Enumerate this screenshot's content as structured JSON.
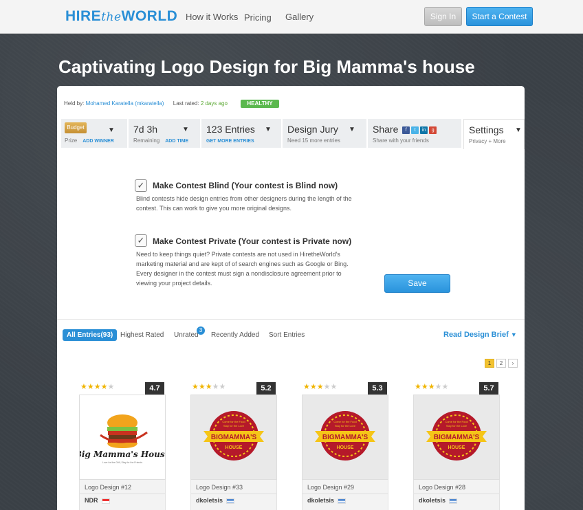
{
  "brand": {
    "part1": "HIRE",
    "part2": "the",
    "part3": "WORLD",
    "color": "#2a8fd6"
  },
  "nav": {
    "how": "How it Works",
    "pricing": "Pricing",
    "gallery": "Gallery",
    "signin": "Sign In",
    "start": "Start a Contest"
  },
  "title": "Captivating Logo Design for Big Mamma's house",
  "held": {
    "label": "Held by:",
    "user": "Mohamed Karatella (mkaratella)",
    "rated_label": "Last rated:",
    "rated_value": "2 days ago",
    "status": "HEALTHY"
  },
  "tabs": {
    "budget": {
      "chip": "Budget",
      "sub": "Prize",
      "link": "ADD WINNER"
    },
    "time": {
      "big": "7d 3h",
      "sub": "Remaining",
      "link": "ADD TIME"
    },
    "entries": {
      "big": "123 Entries",
      "link": "GET MORE ENTRIES"
    },
    "jury": {
      "big": "Design Jury",
      "sub": "Need 15 more entries"
    },
    "share": {
      "big": "Share",
      "sub": "Share with your friends"
    },
    "settings": {
      "big": "Settings",
      "sub": "Privacy + More"
    }
  },
  "options": {
    "blind": {
      "title": "Make Contest Blind  (Your contest  is Blind now)",
      "desc": "Blind contests hide design entries from other designers during the length of the contest. This can work to give you more original designs.",
      "checked": true
    },
    "private": {
      "title": "Make Contest Private (Your contest is Private now)",
      "desc": "Need to keep things quiet? Private contests are not used in HiretheWorld’s marketing material and are kept of of search engines such as Google or Bing. Every designer in the contest must sign a nondisclosure agreement prior to viewing your project details.",
      "checked": true
    },
    "save": "Save"
  },
  "filters": {
    "all": "All Entries(93)",
    "highest": "Highest Rated",
    "unrated": "Unrated",
    "unrated_count": "3",
    "recent": "Recently Added",
    "sort": "Sort Entries",
    "brief": "Read Design Brief"
  },
  "pages": [
    "1",
    "2",
    "›"
  ],
  "entries": [
    {
      "name": "Logo Design #12",
      "author": "NDR",
      "score": "4.7",
      "stars": 4
    },
    {
      "name": "Logo Design #33",
      "author": "dkoletsis",
      "score": "5.2",
      "stars": 3
    },
    {
      "name": "Logo Design #29",
      "author": "dkoletsis",
      "score": "5.3",
      "stars": 3
    },
    {
      "name": "Logo Design #28",
      "author": "dkoletsis",
      "score": "5.7",
      "stars": 3
    }
  ],
  "logo_text": {
    "bmh1": "Big Mamma's House",
    "bmh_tag": "Love for the Grill, Stay for the Friends",
    "badge_top": "Come for the Food",
    "badge_top2": "Stay for the Love",
    "badge_main": "BIGMAMMA'S",
    "badge_sub": "HOUSE"
  }
}
